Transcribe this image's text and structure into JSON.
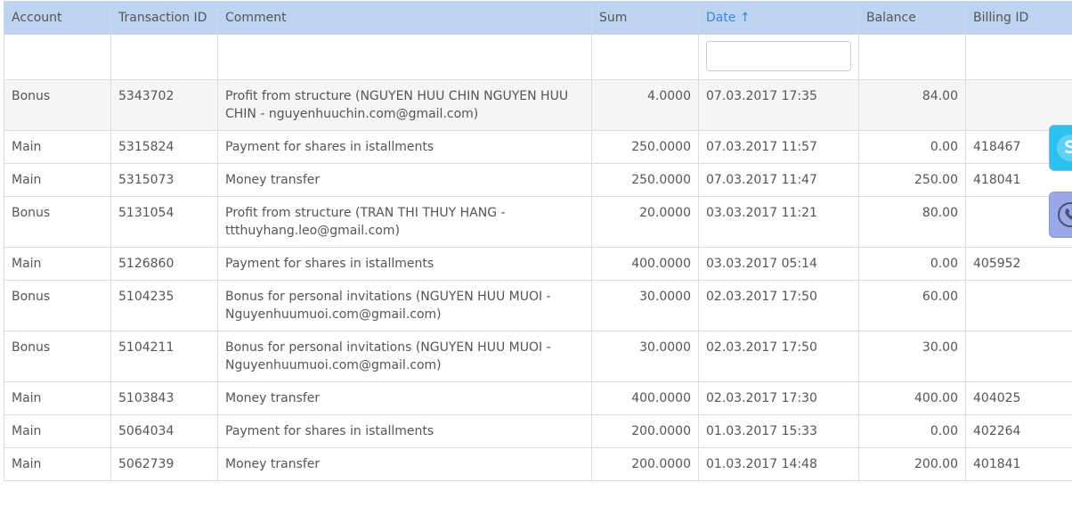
{
  "table": {
    "columns": {
      "account": "Account",
      "transaction_id": "Transaction ID",
      "comment": "Comment",
      "sum": "Sum",
      "date": "Date ↑",
      "balance": "Balance",
      "billing_id": "Billing ID"
    },
    "filter": {
      "date_value": ""
    },
    "rows": [
      {
        "account": "Bonus",
        "transaction_id": "5343702",
        "comment": "Profit from structure (NGUYEN HUU CHIN NGUYEN HUU CHIN - nguyenhuuchin.com@gmail.com)",
        "sum": "4.0000",
        "date": "07.03.2017 17:35",
        "balance": "84.00",
        "billing_id": ""
      },
      {
        "account": "Main",
        "transaction_id": "5315824",
        "comment": "Payment for shares in istallments",
        "sum": "250.0000",
        "date": "07.03.2017 11:57",
        "balance": "0.00",
        "billing_id": "418467"
      },
      {
        "account": "Main",
        "transaction_id": "5315073",
        "comment": "Money transfer",
        "sum": "250.0000",
        "date": "07.03.2017 11:47",
        "balance": "250.00",
        "billing_id": "418041"
      },
      {
        "account": "Bonus",
        "transaction_id": "5131054",
        "comment": "Profit from structure (TRAN THI THUY HANG - ttthuyhang.leo@gmail.com)",
        "sum": "20.0000",
        "date": "03.03.2017 11:21",
        "balance": "80.00",
        "billing_id": ""
      },
      {
        "account": "Main",
        "transaction_id": "5126860",
        "comment": "Payment for shares in istallments",
        "sum": "400.0000",
        "date": "03.03.2017 05:14",
        "balance": "0.00",
        "billing_id": "405952"
      },
      {
        "account": "Bonus",
        "transaction_id": "5104235",
        "comment": "Bonus for personal invitations (NGUYEN HUU MUOI - Nguyenhuumuoi.com@gmail.com)",
        "sum": "30.0000",
        "date": "02.03.2017 17:50",
        "balance": "60.00",
        "billing_id": ""
      },
      {
        "account": "Bonus",
        "transaction_id": "5104211",
        "comment": "Bonus for personal invitations (NGUYEN HUU MUOI - Nguyenhuumuoi.com@gmail.com)",
        "sum": "30.0000",
        "date": "02.03.2017 17:50",
        "balance": "30.00",
        "billing_id": ""
      },
      {
        "account": "Main",
        "transaction_id": "5103843",
        "comment": "Money transfer",
        "sum": "400.0000",
        "date": "02.03.2017 17:30",
        "balance": "400.00",
        "billing_id": "404025"
      },
      {
        "account": "Main",
        "transaction_id": "5064034",
        "comment": "Payment for shares in istallments",
        "sum": "200.0000",
        "date": "01.03.2017 15:33",
        "balance": "0.00",
        "billing_id": "402264"
      },
      {
        "account": "Main",
        "transaction_id": "5062739",
        "comment": "Money transfer",
        "sum": "200.0000",
        "date": "01.03.2017 14:48",
        "balance": "200.00",
        "billing_id": "401841"
      }
    ]
  },
  "side_buttons": {
    "skype_icon": "skype-icon",
    "phone_icon": "phone-icon"
  },
  "colors": {
    "header_bg": "#bdd4f1",
    "sorted_header": "#3b87d6",
    "skype": "#2bc2f0",
    "phone": "#9aa8e8"
  }
}
